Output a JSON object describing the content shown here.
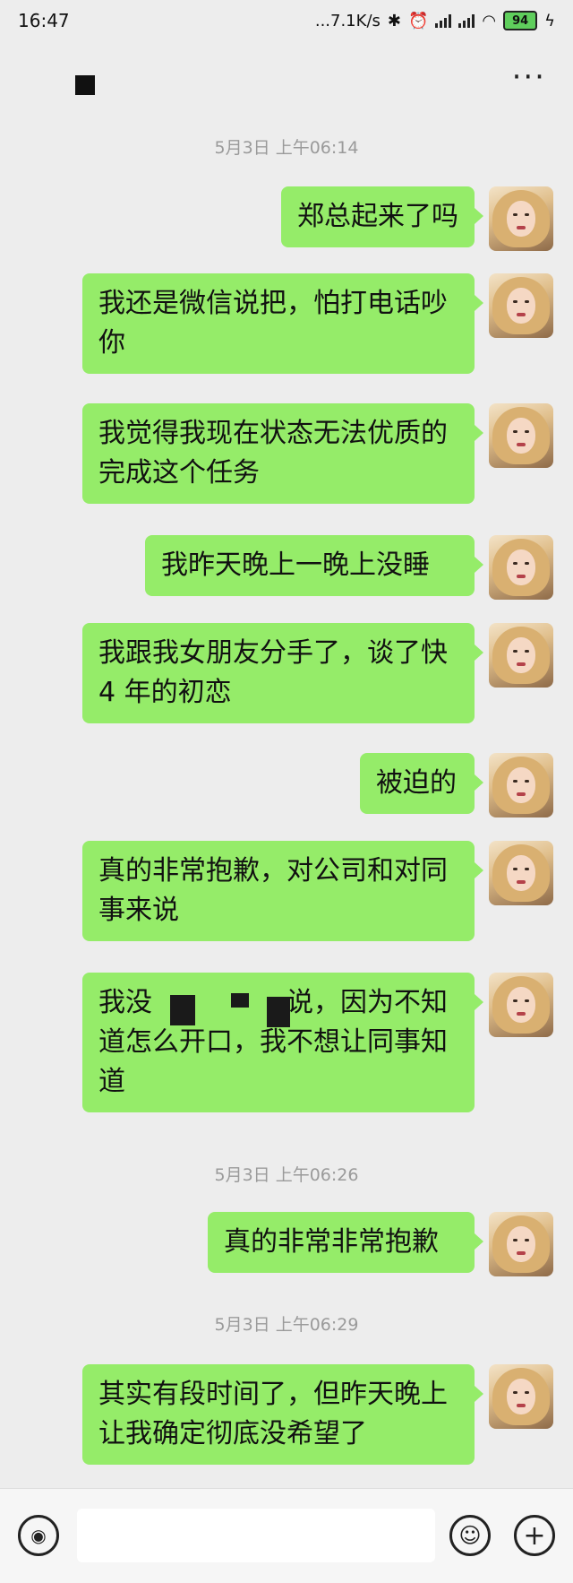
{
  "status": {
    "time": "16:47",
    "network_speed": "...7.1K/s",
    "battery": "94"
  },
  "chat": {
    "title": "",
    "timestamps": [
      "5月3日 上午06:14",
      "5月3日 上午06:26",
      "5月3日 上午06:29"
    ],
    "messages": [
      "郑总起来了吗",
      "我还是微信说把，怕打电话吵你",
      "我觉得我现在状态无法优质的完成这个任务",
      "我昨天晚上一晚上没睡",
      "我跟我女朋友分手了，谈了快 4 年的初恋",
      "被迫的",
      "真的非常抱歉，对公司和对同事来说",
      "我没　　　　　说，因为不知道怎么开口，我不想让同事知道",
      "真的非常非常抱歉",
      "其实有段时间了，但昨天晚上让我确定彻底没希望了"
    ]
  },
  "icons": {
    "more": "more-icon",
    "voice": "voice-icon",
    "emoji": "emoji-icon",
    "add": "add-icon"
  },
  "colors": {
    "bubble": "#95ec69",
    "background": "#ededed"
  }
}
